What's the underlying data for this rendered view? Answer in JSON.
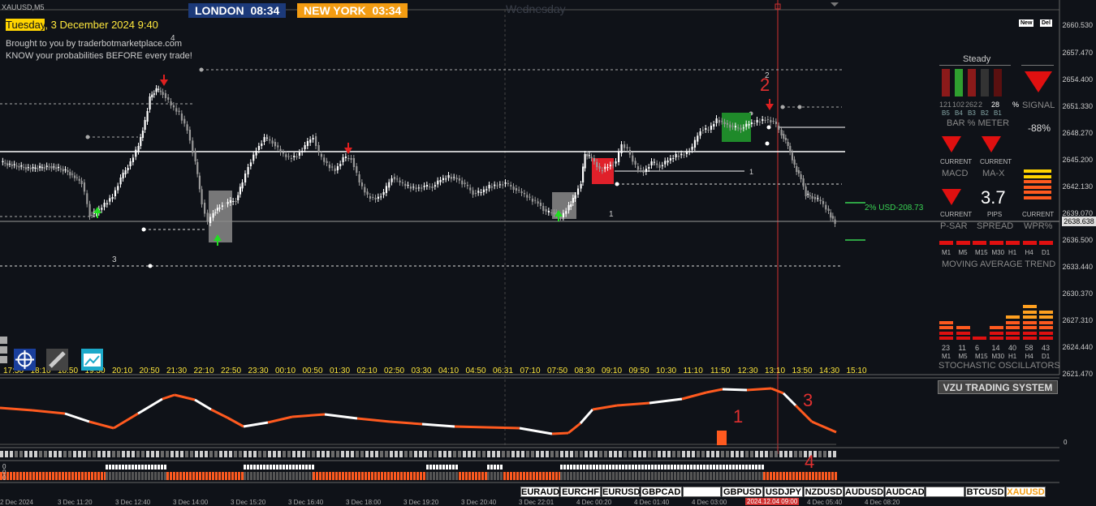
{
  "symbol": "XAUUSD,M5",
  "sessions": [
    {
      "city": "LONDON",
      "time": "08:34",
      "color": "#1c3a7a"
    },
    {
      "city": "NEW YORK",
      "time": "03:34",
      "color": "#f39c12"
    }
  ],
  "day_watermark": "Wednesday",
  "date_line": {
    "day": "Tuesday",
    "rest": ", 3 December 2024 9:40"
  },
  "promo": [
    "Brought to you by traderbotmarketplace.com",
    "KNOW your probabilities BEFORE every trade!"
  ],
  "price_axis": [
    "2660.530",
    "2657.470",
    "2654.400",
    "2651.330",
    "2648.270",
    "2645.200",
    "2642.130",
    "2639.070",
    "2636.500",
    "2633.440",
    "2630.370",
    "2627.310",
    "2624.440",
    "2621.470"
  ],
  "current_price": "2638.638",
  "usd_label": "2% USD-208.73",
  "time_axis": [
    "17:30",
    "18:10",
    "18:50",
    "19:30",
    "20:10",
    "20:50",
    "21:30",
    "22:10",
    "22:50",
    "23:30",
    "00:10",
    "00:50",
    "01:30",
    "02:10",
    "02:50",
    "03:30",
    "04:10",
    "04:50",
    "06:31",
    "07:10",
    "07:50",
    "08:30",
    "09:10",
    "09:50",
    "10:30",
    "11:10",
    "11:50",
    "12:30",
    "13:10",
    "13:50",
    "14:30",
    "15:10"
  ],
  "bottom_dates": [
    "2 Dec 2024",
    "3 Dec 11:20",
    "3 Dec 12:40",
    "3 Dec 14:00",
    "3 Dec 15:20",
    "3 Dec 16:40",
    "3 Dec 18:00",
    "3 Dec 19:20",
    "3 Dec 20:40",
    "3 Dec 22:01",
    "4 Dec 00:20",
    "4 Dec 01:40",
    "4 Dec 03:00",
    "4 Dec 04:20",
    "4 Dec 05:40",
    "4 Dec 08:20"
  ],
  "bottom_date_highlight": "2024.12.04 09:00",
  "level_labels": [
    "4",
    "3",
    "2",
    "1",
    "1",
    "2",
    "1",
    "3",
    "4"
  ],
  "panel": {
    "new_btn": "New",
    "del_btn": "Del",
    "steady": "Steady",
    "bar_meter_values": [
      "121",
      "102",
      "262",
      "2",
      "28"
    ],
    "bar_meter_pct": "%",
    "bar_meter_frames": [
      "B5",
      "B4",
      "B3",
      "B2",
      "B1"
    ],
    "bar_meter_title": "BAR % METER",
    "signal": "SIGNAL",
    "bar_pct": "-88%",
    "macd": {
      "state": "CURRENT",
      "label": "MACD"
    },
    "max": {
      "state": "CURRENT",
      "label": "MA-X"
    },
    "psar": {
      "state": "CURRENT",
      "label": "P-SAR"
    },
    "spread": {
      "value": "3.7",
      "unit": "PIPS",
      "label": "SPREAD"
    },
    "wpr": {
      "state": "CURRENT",
      "label": "WPR%"
    },
    "tf": [
      "M1",
      "M5",
      "M15",
      "M30",
      "H1",
      "H4",
      "D1"
    ],
    "ma_trend_title": "MOVING AVERAGE TREND",
    "stoch_values": [
      "23",
      "11",
      "6",
      "14",
      "40",
      "58",
      "43"
    ],
    "stoch_title": "STOCHASTIC OSCILLATORS",
    "vzu": "VZU TRADING SYSTEM"
  },
  "indicator_labels": {
    "osc_zero": "0",
    "bar0": "0",
    "bar1": "0",
    "bar2": "0",
    "red_1": "1",
    "red_2": "2",
    "red_3": "3",
    "red_4": "4"
  },
  "tabs": [
    "EURAUD",
    "EURCHF",
    "EURUSD",
    "GBPCAD",
    "",
    "GBPUSD",
    "USDJPY",
    "NZDUSD",
    "AUDUSD",
    "AUDCAD",
    "",
    "BTCUSD",
    "XAUUSD"
  ],
  "active_tab": "XAUUSD"
}
